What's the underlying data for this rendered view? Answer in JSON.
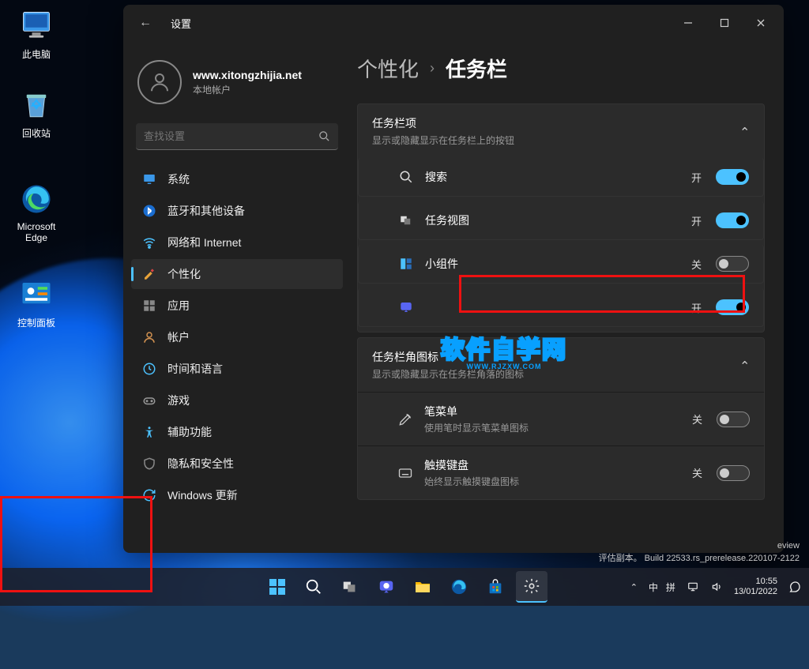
{
  "desktop": {
    "icons": [
      {
        "name": "this-pc",
        "label": "此电脑"
      },
      {
        "name": "recycle-bin",
        "label": "回收站"
      },
      {
        "name": "edge",
        "label": "Microsoft Edge"
      },
      {
        "name": "control-panel",
        "label": "控制面板"
      }
    ]
  },
  "settings": {
    "title": "设置",
    "user": {
      "name": "www.xitongzhijia.net",
      "account": "本地帐户"
    },
    "search_placeholder": "查找设置",
    "nav": [
      {
        "icon": "system",
        "label": "系统"
      },
      {
        "icon": "bluetooth",
        "label": "蓝牙和其他设备"
      },
      {
        "icon": "network",
        "label": "网络和 Internet"
      },
      {
        "icon": "personalize",
        "label": "个性化",
        "active": true
      },
      {
        "icon": "apps",
        "label": "应用"
      },
      {
        "icon": "accounts",
        "label": "帐户"
      },
      {
        "icon": "time",
        "label": "时间和语言"
      },
      {
        "icon": "gaming",
        "label": "游戏"
      },
      {
        "icon": "accessibility",
        "label": "辅助功能"
      },
      {
        "icon": "privacy",
        "label": "隐私和安全性"
      },
      {
        "icon": "update",
        "label": "Windows 更新"
      }
    ],
    "breadcrumb": {
      "parent": "个性化",
      "sep": "›",
      "current": "任务栏"
    },
    "section1": {
      "title": "任务栏项",
      "sub": "显示或隐藏显示在任务栏上的按钮",
      "rows": [
        {
          "icon": "search",
          "label": "搜索",
          "state": "开",
          "on": true
        },
        {
          "icon": "taskview",
          "label": "任务视图",
          "state": "开",
          "on": true
        },
        {
          "icon": "widgets",
          "label": "小组件",
          "state": "关",
          "on": false
        },
        {
          "icon": "chat",
          "label": "",
          "state": "开",
          "on": true
        }
      ]
    },
    "section2": {
      "title": "任务栏角图标",
      "sub": "显示或隐藏显示在任务栏角落的图标",
      "rows": [
        {
          "icon": "pen",
          "label": "笔菜单",
          "sub": "使用笔时显示笔菜单图标",
          "state": "关",
          "on": false
        },
        {
          "icon": "touchkbd",
          "label": "触摸键盘",
          "sub": "始终显示触摸键盘图标",
          "state": "关",
          "on": false
        }
      ]
    }
  },
  "build": {
    "line1": "eview",
    "line2": "评估副本。 Build 22533.rs_prerelease.220107-2122"
  },
  "tray": {
    "ime": [
      "中",
      "拼"
    ],
    "time": "10:55",
    "date": "13/01/2022"
  },
  "watermark": {
    "main": "软件自学网",
    "sub": "WWW.RJZXW.COM"
  }
}
